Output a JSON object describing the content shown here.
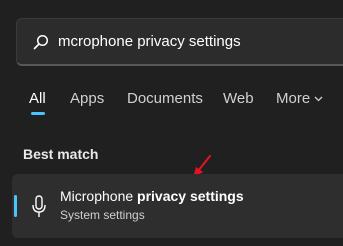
{
  "search": {
    "value": "mcrophone privacy settings",
    "icon": "search-icon"
  },
  "tabs": [
    {
      "label": "All",
      "active": true
    },
    {
      "label": "Apps"
    },
    {
      "label": "Documents"
    },
    {
      "label": "Web"
    },
    {
      "label": "More"
    }
  ],
  "section": {
    "title": "Best match"
  },
  "result": {
    "title_plain": "Microphone ",
    "title_bold": "privacy settings",
    "subtitle": "System settings",
    "icon": "microphone-icon"
  },
  "colors": {
    "background": "#202020",
    "accent": "#4cc2ff",
    "annotation_arrow": "#e81123"
  }
}
